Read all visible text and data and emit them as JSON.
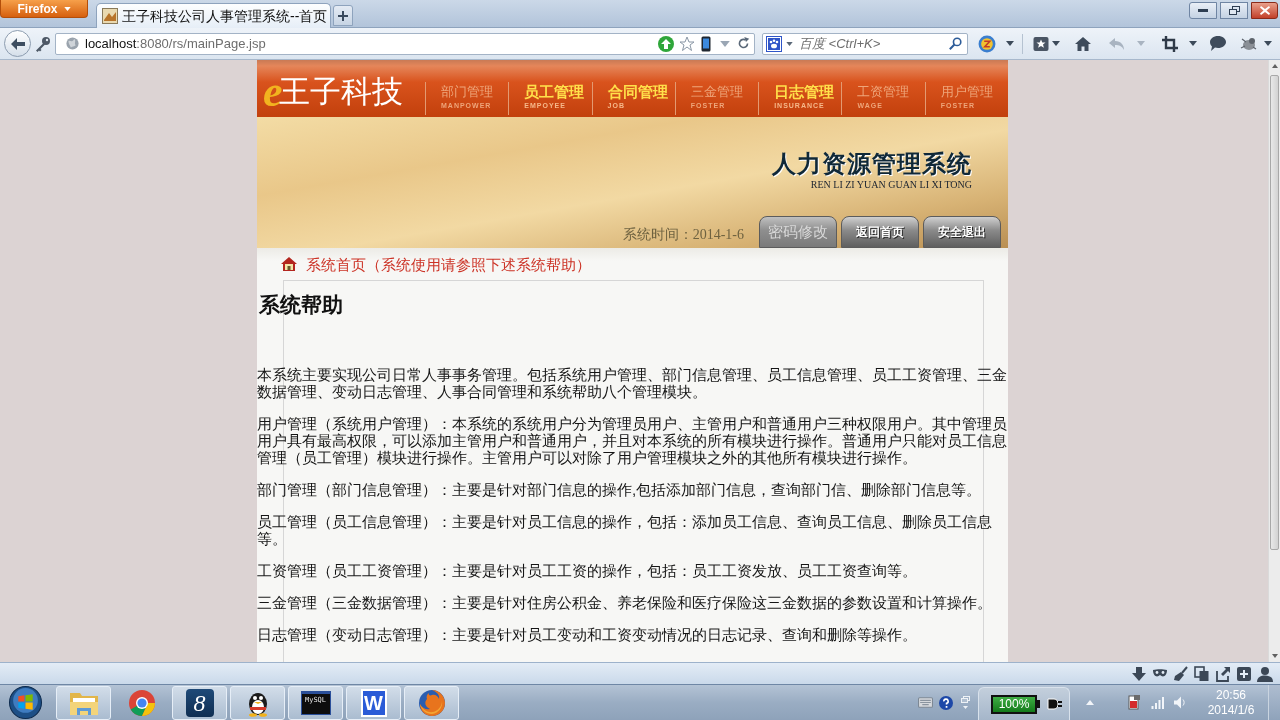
{
  "browser": {
    "menu_button": "Firefox",
    "tab_title": "王子科技公司人事管理系统--首页",
    "address": {
      "host": "localhost",
      "path": ":8080/rs/mainPage.jsp"
    },
    "search": {
      "placeholder": "百度 <Ctrl+K>"
    }
  },
  "header": {
    "logo": {
      "mark": "e",
      "name": "王子科技"
    },
    "nav": [
      {
        "label": "部门管理",
        "sub": "MANPOWER",
        "highlighted": false
      },
      {
        "label": "员工管理",
        "sub": "EMPOYEE",
        "highlighted": true
      },
      {
        "label": "合同管理",
        "sub": "JOB",
        "highlighted": true
      },
      {
        "label": "三金管理",
        "sub": "FOSTER",
        "highlighted": false
      },
      {
        "label": "日志管理",
        "sub": "INSURANCE",
        "highlighted": true
      },
      {
        "label": "工资管理",
        "sub": "WAGE",
        "highlighted": false
      },
      {
        "label": "用户管理",
        "sub": "FOSTER",
        "highlighted": false
      }
    ],
    "banner": {
      "title": "人力资源管理系统",
      "subtitle": "REN LI ZI YUAN GUAN LI XI TONG"
    },
    "system_time": "系统时间：2014-1-6",
    "buttons": [
      {
        "label": "密码修改",
        "disabled": true
      },
      {
        "label": "返回首页",
        "disabled": false
      },
      {
        "label": "安全退出",
        "disabled": false
      }
    ]
  },
  "breadcrumb": "系统首页（系统使用请参照下述系统帮助）",
  "help": {
    "title": "系统帮助",
    "paragraphs": [
      "本系统主要实现公司日常人事事务管理。包括系统用户管理、部门信息管理、员工信息管理、员工工资管理、三金数据管理、变动日志管理、人事合同管理和系统帮助八个管理模块。",
      "用户管理（系统用户管理）：本系统的系统用户分为管理员用户、主管用户和普通用户三种权限用户。其中管理员用户具有最高权限，可以添加主管用户和普通用户，并且对本系统的所有模块进行操作。普通用户只能对员工信息管理（员工管理）模块进行操作。主管用户可以对除了用户管理模块之外的其他所有模块进行操作。",
      "部门管理（部门信息管理）：主要是针对部门信息的操作,包括添加部门信息，查询部门信、删除部门信息等。",
      "员工管理（员工信息管理）：主要是针对员工信息的操作，包括：添加员工信息、查询员工信息、删除员工信息等。",
      "工资管理（员工工资管理）：主要是针对员工工资的操作，包括：员工工资发放、员工工资查询等。",
      "三金管理（三金数据管理）：主要是针对住房公积金、养老保险和医疗保险这三金数据的参数设置和计算操作。",
      "日志管理（变动日志管理）：主要是针对员工变动和工资变动情况的日志记录、查询和删除等操作。"
    ]
  },
  "taskbar": {
    "apps": [
      {
        "kind": "explorer",
        "running": true
      },
      {
        "kind": "chrome",
        "running": false
      },
      {
        "kind": "eight",
        "glyph": "8",
        "running": true
      },
      {
        "kind": "qq",
        "running": true
      },
      {
        "kind": "terminal",
        "glyph": "MySQL",
        "running": true
      },
      {
        "kind": "wps",
        "glyph": "W",
        "running": true
      },
      {
        "kind": "firefox",
        "running": true
      }
    ],
    "battery": "100%",
    "time": "20:56",
    "date": "2014/1/6"
  }
}
